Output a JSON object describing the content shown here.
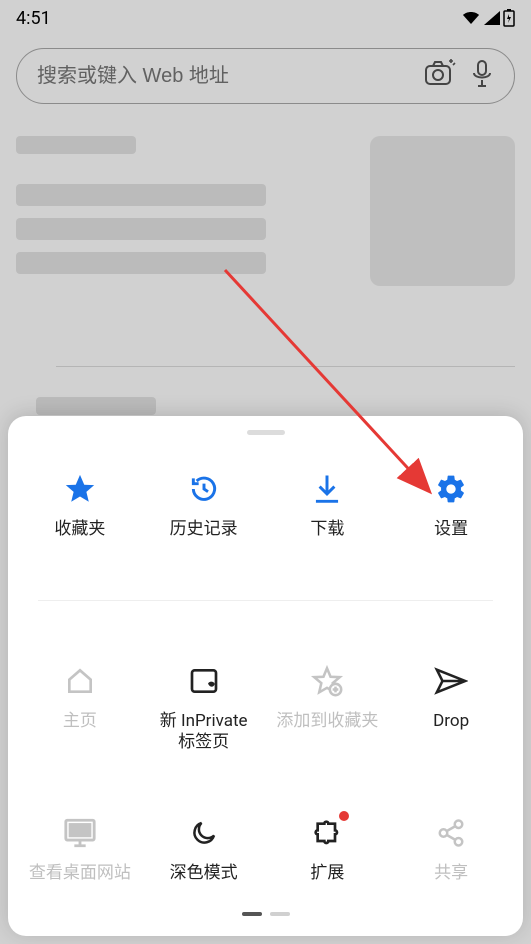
{
  "status": {
    "time": "4:51"
  },
  "search": {
    "placeholder": "搜索或键入 Web 地址"
  },
  "sheet": {
    "row1": [
      {
        "key": "favorites",
        "label": "收藏夹",
        "icon": "star",
        "color": "#1a73e8",
        "active": true
      },
      {
        "key": "history",
        "label": "历史记录",
        "icon": "history",
        "color": "#1a73e8",
        "active": true
      },
      {
        "key": "downloads",
        "label": "下载",
        "icon": "download",
        "color": "#1a73e8",
        "active": true
      },
      {
        "key": "settings",
        "label": "设置",
        "icon": "gear",
        "color": "#1a73e8",
        "active": true
      }
    ],
    "row2": [
      {
        "key": "home",
        "label": "主页",
        "icon": "home",
        "disabled": true
      },
      {
        "key": "inprivate",
        "label": "新 InPrivate\n标签页",
        "icon": "inprivate",
        "active": true
      },
      {
        "key": "addfav",
        "label": "添加到收藏夹",
        "icon": "star-plus",
        "disabled": true
      },
      {
        "key": "drop",
        "label": "Drop",
        "icon": "send",
        "active": true
      }
    ],
    "row3": [
      {
        "key": "desktop",
        "label": "查看桌面网站",
        "icon": "monitor",
        "disabled": true
      },
      {
        "key": "dark",
        "label": "深色模式",
        "icon": "moon",
        "active": true
      },
      {
        "key": "extensions",
        "label": "扩展",
        "icon": "puzzle",
        "active": true,
        "badge": true
      },
      {
        "key": "share",
        "label": "共享",
        "icon": "share",
        "disabled": true
      }
    ]
  }
}
